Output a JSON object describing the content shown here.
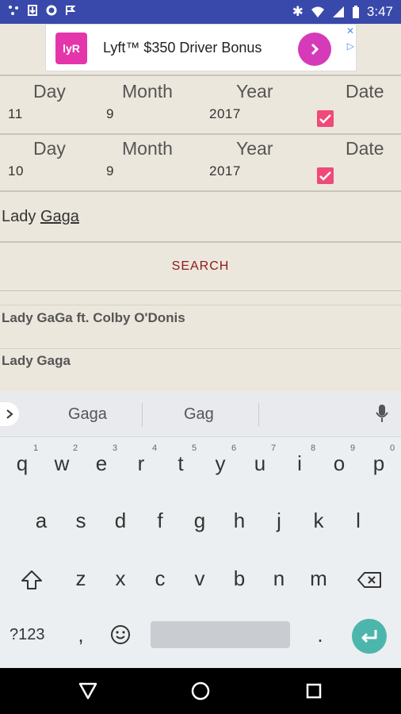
{
  "status_bar": {
    "time": "3:47"
  },
  "ad": {
    "logo_text": "lyR",
    "text": "Lyft™ $350 Driver Bonus",
    "close": "✕",
    "info": "▷"
  },
  "rows": [
    {
      "day_label": "Day",
      "month_label": "Month",
      "year_label": "Year",
      "date_label": "Date",
      "day": "11",
      "month": "9",
      "year": "2017",
      "checked": true
    },
    {
      "day_label": "Day",
      "month_label": "Month",
      "year_label": "Year",
      "date_label": "Date",
      "day": "10",
      "month": "9",
      "year": "2017",
      "checked": true
    }
  ],
  "artist_input": {
    "prefix": "Lady ",
    "underlined": "Gaga"
  },
  "search_button": "SEARCH",
  "results": [
    "Lady GaGa ft. Colby O'Donis",
    "Lady Gaga"
  ],
  "keyboard": {
    "suggestions": [
      "Gaga",
      "Gag"
    ],
    "row1": [
      "q",
      "w",
      "e",
      "r",
      "t",
      "y",
      "u",
      "i",
      "o",
      "p"
    ],
    "row1_hints": [
      "1",
      "2",
      "3",
      "4",
      "5",
      "6",
      "7",
      "8",
      "9",
      "0"
    ],
    "row2": [
      "a",
      "s",
      "d",
      "f",
      "g",
      "h",
      "j",
      "k",
      "l"
    ],
    "row3": [
      "z",
      "x",
      "c",
      "v",
      "b",
      "n",
      "m"
    ],
    "symbols_key": "?123",
    "comma": ",",
    "period": "."
  }
}
